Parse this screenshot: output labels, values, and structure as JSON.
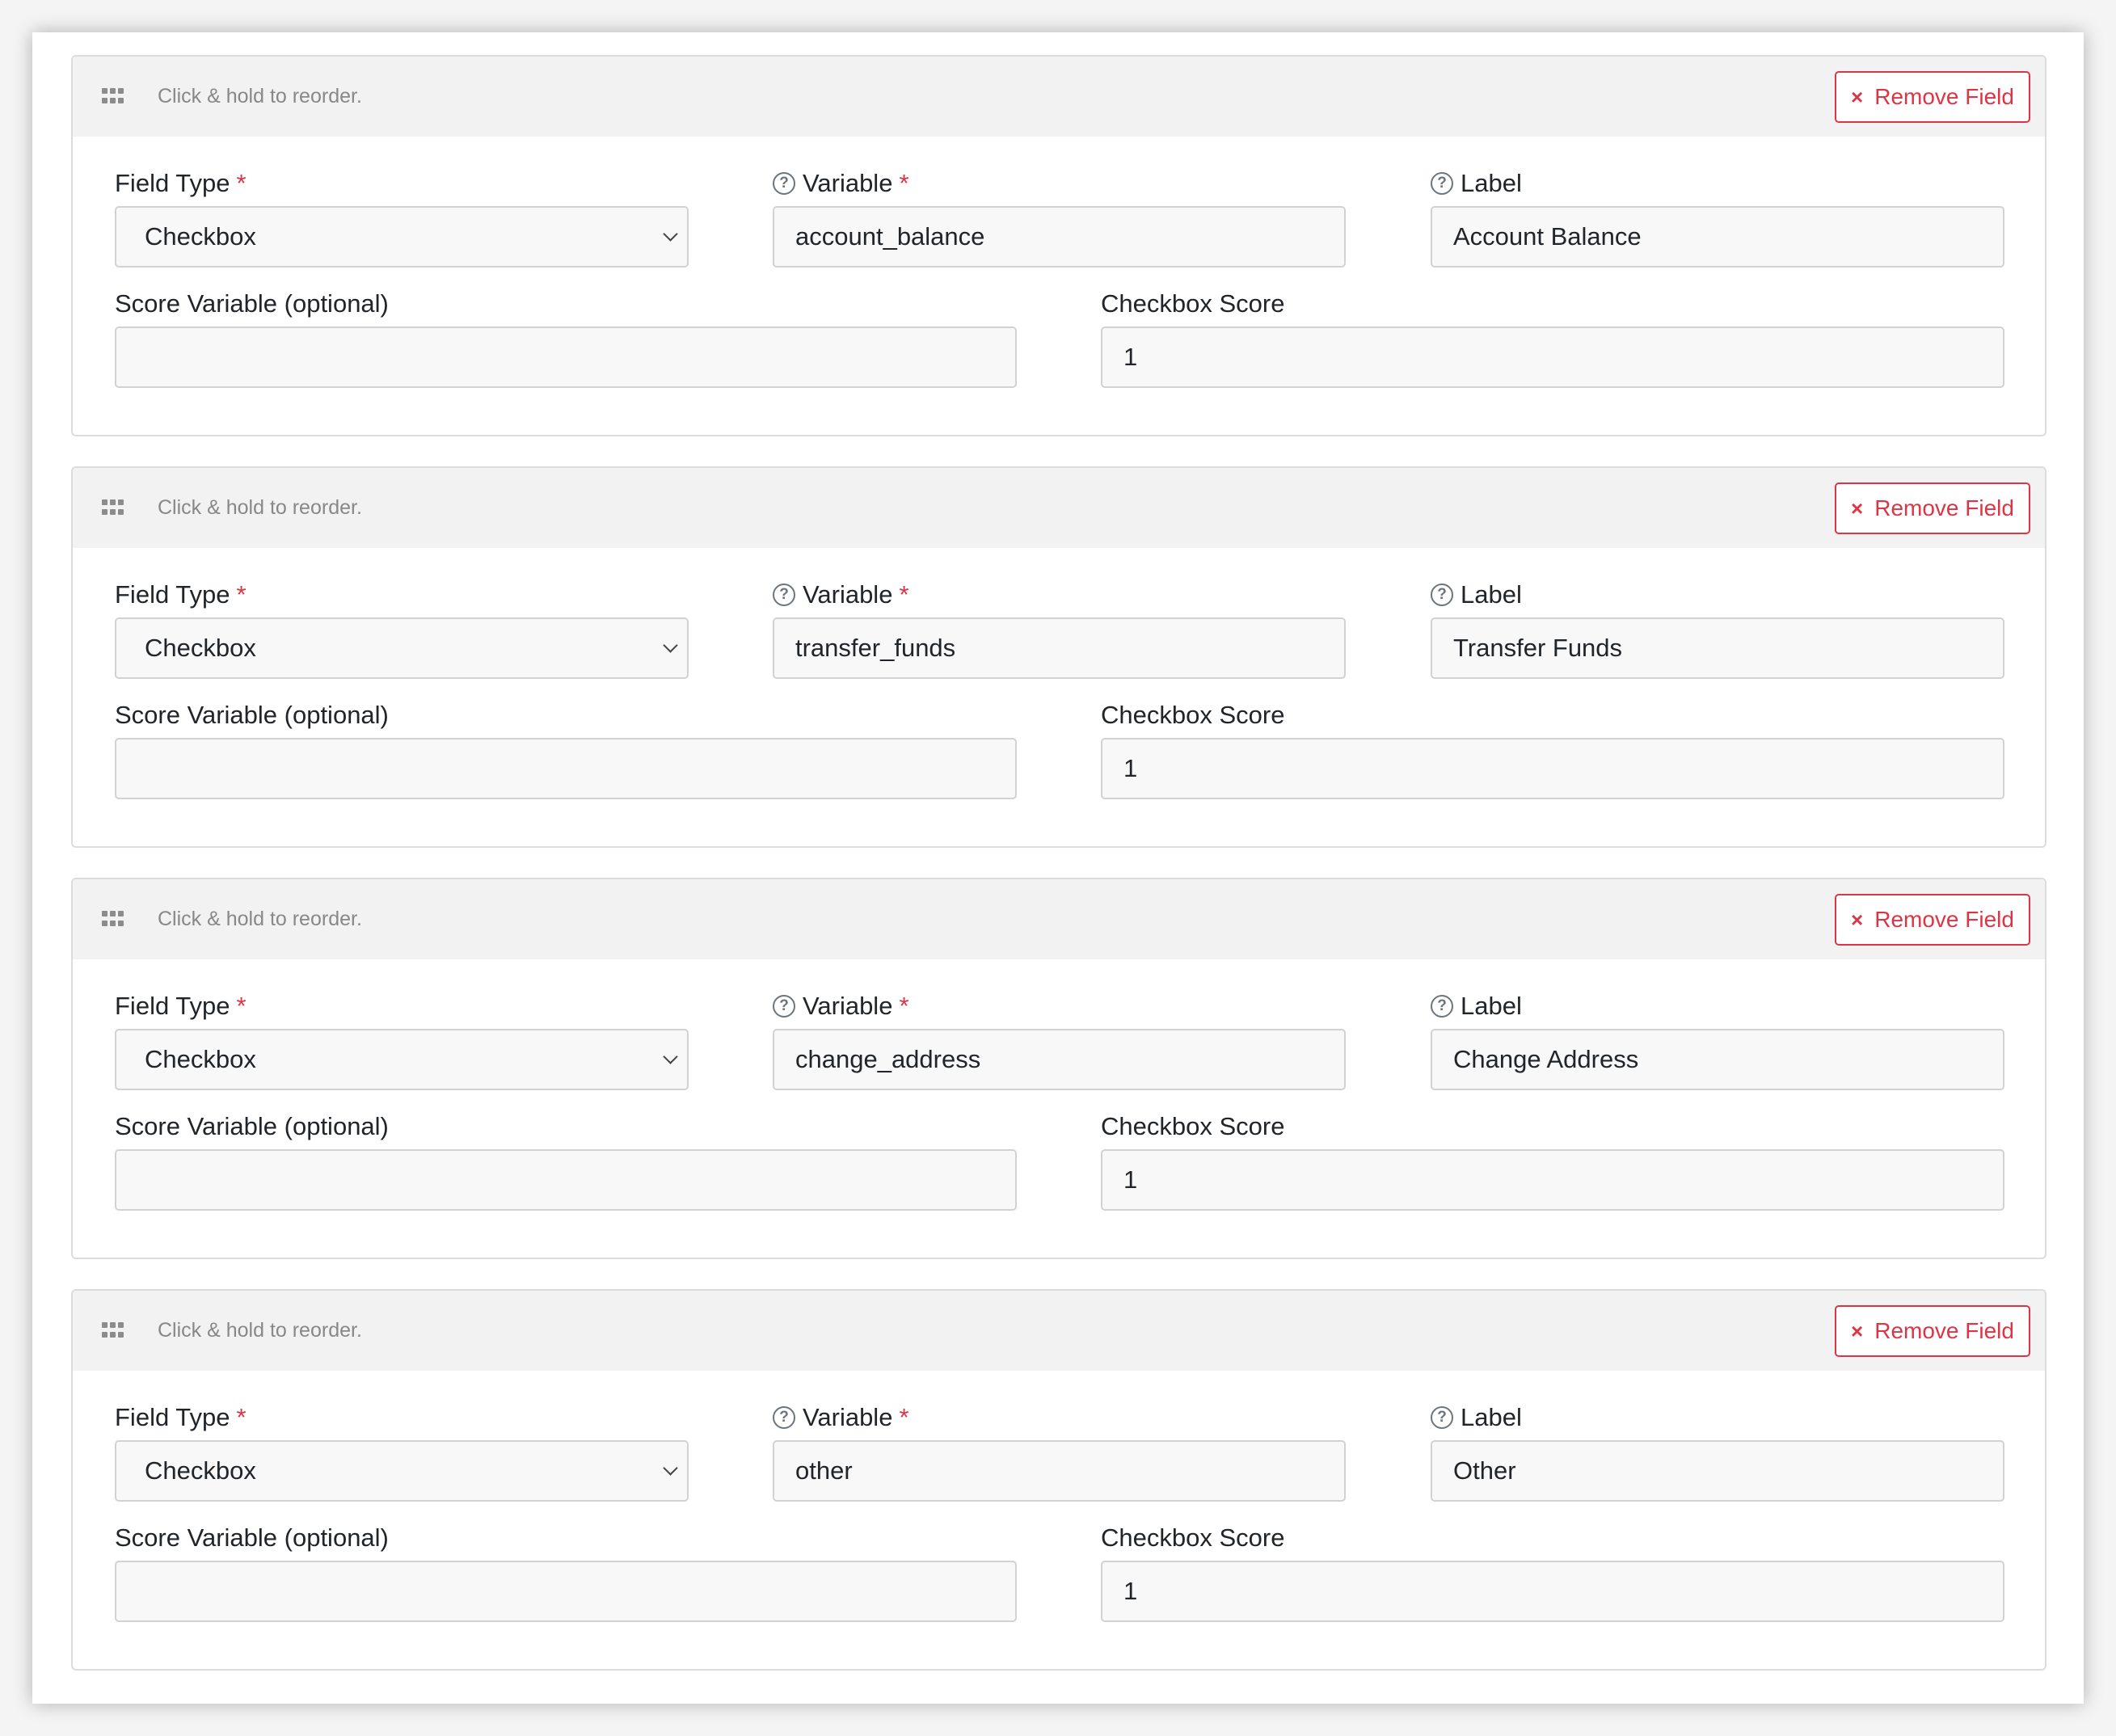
{
  "labels": {
    "field_type": "Field Type",
    "variable": "Variable",
    "label": "Label",
    "score_variable": "Score Variable (optional)",
    "checkbox_score": "Checkbox Score",
    "required_marker": "*",
    "help_glyph": "?"
  },
  "header": {
    "reorder_hint": "Click & hold to reorder.",
    "remove_label": "Remove Field",
    "remove_glyph": "×"
  },
  "colors": {
    "danger": "#dc3545",
    "header_bg": "#f2f2f2",
    "input_bg": "#f8f8f8"
  },
  "fields": [
    {
      "field_type": "Checkbox",
      "variable": "account_balance",
      "label": "Account Balance",
      "score_variable": "",
      "checkbox_score": "1"
    },
    {
      "field_type": "Checkbox",
      "variable": "transfer_funds",
      "label": "Transfer Funds",
      "score_variable": "",
      "checkbox_score": "1"
    },
    {
      "field_type": "Checkbox",
      "variable": "change_address",
      "label": "Change Address",
      "score_variable": "",
      "checkbox_score": "1"
    },
    {
      "field_type": "Checkbox",
      "variable": "other",
      "label": "Other",
      "score_variable": "",
      "checkbox_score": "1"
    }
  ]
}
